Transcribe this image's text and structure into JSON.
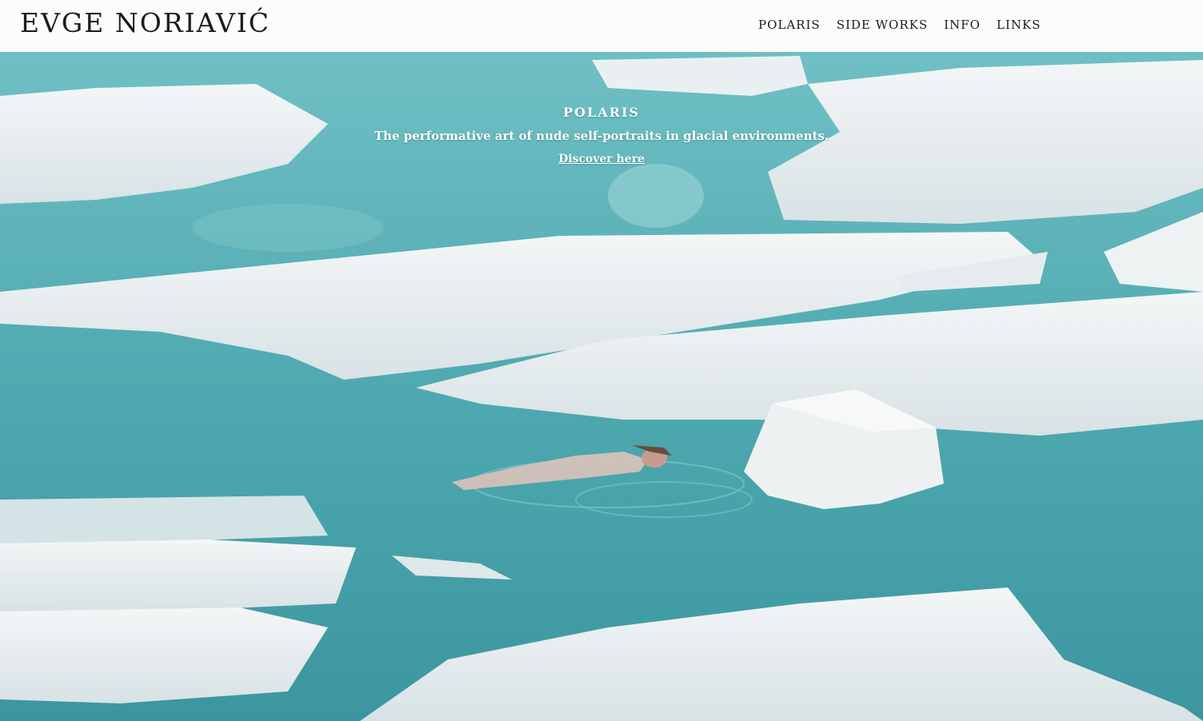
{
  "site": {
    "title": "EVGE NORIAVIĆ"
  },
  "nav": {
    "items": [
      {
        "label": "POLARIS"
      },
      {
        "label": "SIDE WORKS"
      },
      {
        "label": "INFO"
      },
      {
        "label": "LINKS"
      }
    ]
  },
  "hero": {
    "title": "POLARIS",
    "subtitle": "The performative art of nude self-portraits in glacial environments.",
    "link_label": "Discover here",
    "image": "photo of a person floating in turquoise glacial water among ice floes"
  },
  "colors": {
    "water": "#5fb5bb",
    "water_deep": "#3f9ea6",
    "ice": "#e9eef0",
    "ice_shadow": "#c9d6da",
    "header_bg": "#fcfcfb",
    "text_dark": "#1b1b1b"
  }
}
